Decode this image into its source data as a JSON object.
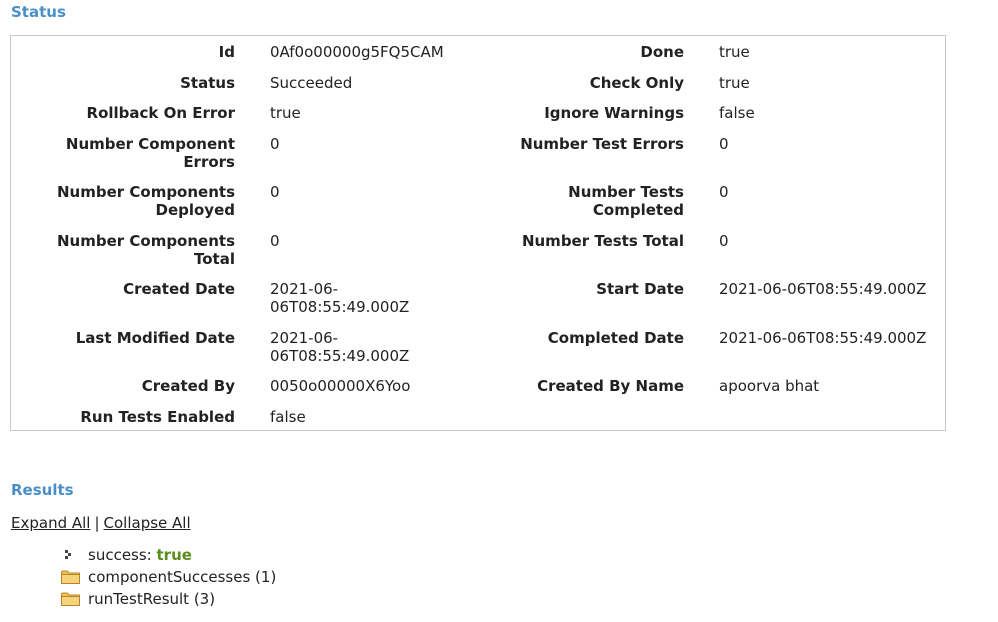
{
  "status": {
    "title": "Status",
    "rows": [
      {
        "label1": "Id",
        "value1": "0Af0o00000g5FQ5CAM",
        "label2": "Done",
        "value2": "true"
      },
      {
        "label1": "Status",
        "value1": "Succeeded",
        "label2": "Check Only",
        "value2": "true"
      },
      {
        "label1": "Rollback On Error",
        "value1": "true",
        "label2": "Ignore Warnings",
        "value2": "false"
      },
      {
        "label1": "Number Component Errors",
        "value1": "0",
        "label2": "Number Test Errors",
        "value2": "0"
      },
      {
        "label1": "Number Components Deployed",
        "value1": "0",
        "label2": "Number Tests Completed",
        "value2": "0"
      },
      {
        "label1": "Number Components Total",
        "value1": "0",
        "label2": "Number Tests Total",
        "value2": "0"
      },
      {
        "label1": "Created Date",
        "value1": "2021-06-06T08:55:49.000Z",
        "label2": "Start Date",
        "value2": "2021-06-06T08:55:49.000Z"
      },
      {
        "label1": "Last Modified Date",
        "value1": "2021-06-06T08:55:49.000Z",
        "label2": "Completed Date",
        "value2": "2021-06-06T08:55:49.000Z"
      },
      {
        "label1": "Created By",
        "value1": "0050o00000X6Yoo",
        "label2": "Created By Name",
        "value2": "apoorva bhat"
      },
      {
        "label1": "Run Tests Enabled",
        "value1": "false",
        "label2": "",
        "value2": ""
      }
    ]
  },
  "results": {
    "title": "Results",
    "expand_all": "Expand All",
    "separator": "|",
    "collapse_all": "Collapse All",
    "items": [
      {
        "icon": "leaf-node-icon",
        "label": "success:",
        "value": "true"
      },
      {
        "icon": "folder-icon",
        "label": "componentSuccesses (1)"
      },
      {
        "icon": "folder-icon",
        "label": "runTestResult (3)"
      }
    ]
  },
  "colors": {
    "section_title": "#4b8fc9",
    "success_value": "#5a8f1e",
    "folder": "#f2c14e"
  }
}
